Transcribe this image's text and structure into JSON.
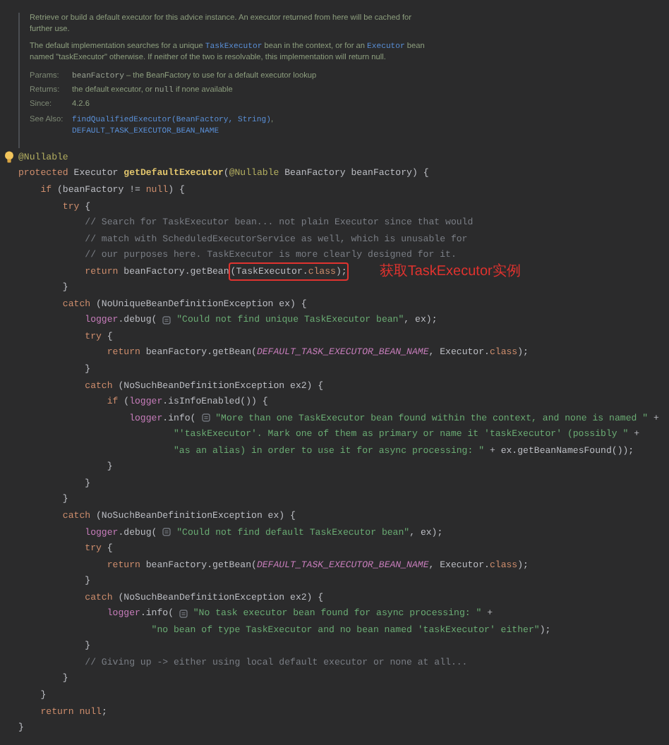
{
  "doc": {
    "paragraphs": [
      [
        {
          "kind": "text",
          "text": "Retrieve or build a default executor for this advice instance. An executor returned from here will be cached for further use."
        }
      ],
      [
        {
          "kind": "text",
          "text": "The default implementation searches for a unique "
        },
        {
          "kind": "link",
          "text": "TaskExecutor"
        },
        {
          "kind": "text",
          "text": " bean in the context, or for an "
        },
        {
          "kind": "link",
          "text": "Executor"
        },
        {
          "kind": "text",
          "text": " bean named \"taskExecutor\" otherwise. If neither of the two is resolvable, this implementation will return null."
        }
      ]
    ],
    "tags": [
      {
        "label": "Params:",
        "lines": [
          [
            {
              "kind": "code",
              "text": "beanFactory"
            },
            {
              "kind": "text",
              "text": " – the BeanFactory to use for a default executor lookup"
            }
          ]
        ]
      },
      {
        "label": "Returns:",
        "lines": [
          [
            {
              "kind": "text",
              "text": "the default executor, or "
            },
            {
              "kind": "code",
              "text": "null"
            },
            {
              "kind": "text",
              "text": " if none available"
            }
          ]
        ]
      },
      {
        "label": "Since:",
        "lines": [
          [
            {
              "kind": "text",
              "text": "4.2.6"
            }
          ]
        ]
      },
      {
        "label": "See Also:",
        "lines": [
          [
            {
              "kind": "link",
              "text": "findQualifiedExecutor(BeanFactory, String)"
            },
            {
              "kind": "text",
              "text": ","
            }
          ],
          [
            {
              "kind": "link",
              "text": "DEFAULT_TASK_EXECUTOR_BEAN_NAME"
            }
          ]
        ]
      }
    ]
  },
  "code": [
    {
      "lightbulb": true,
      "tokens": [
        {
          "kind": "annotation",
          "text": "@Nullable"
        }
      ]
    },
    {
      "tokens": [
        {
          "kind": "keyword",
          "text": "protected"
        },
        {
          "kind": "plain",
          "text": " Executor "
        },
        {
          "kind": "method",
          "text": "getDefaultExecutor"
        },
        {
          "kind": "plain",
          "text": "("
        },
        {
          "kind": "annotation",
          "text": "@Nullable"
        },
        {
          "kind": "plain",
          "text": " BeanFactory beanFactory) {"
        }
      ]
    },
    {
      "tokens": [
        {
          "kind": "keyword",
          "text": "    if"
        },
        {
          "kind": "plain",
          "text": " (beanFactory != "
        },
        {
          "kind": "keyword",
          "text": "null"
        },
        {
          "kind": "plain",
          "text": ") {"
        }
      ]
    },
    {
      "tokens": [
        {
          "kind": "keyword",
          "text": "        try"
        },
        {
          "kind": "plain",
          "text": " {"
        }
      ]
    },
    {
      "tokens": [
        {
          "kind": "comment",
          "text": "            // Search for TaskExecutor bean... not plain Executor since that would"
        }
      ]
    },
    {
      "tokens": [
        {
          "kind": "comment",
          "text": "            // match with ScheduledExecutorService as well, which is unusable for"
        }
      ]
    },
    {
      "tokens": [
        {
          "kind": "comment",
          "text": "            // our purposes here. TaskExecutor is more clearly designed for it."
        }
      ]
    },
    {
      "callout": "获取TaskExecutor实例",
      "tokens": [
        {
          "kind": "keyword",
          "text": "            return"
        },
        {
          "kind": "plain",
          "text": " beanFactory.getBean"
        },
        {
          "kind": "box",
          "tokens": [
            {
              "kind": "plain",
              "text": "(TaskExecutor."
            },
            {
              "kind": "keyword",
              "text": "class"
            },
            {
              "kind": "plain",
              "text": ");"
            }
          ]
        }
      ]
    },
    {
      "tokens": [
        {
          "kind": "plain",
          "text": "        }"
        }
      ]
    },
    {
      "tokens": [
        {
          "kind": "keyword",
          "text": "        catch"
        },
        {
          "kind": "plain",
          "text": " (NoUniqueBeanDefinitionException ex) {"
        }
      ]
    },
    {
      "tokens": [
        {
          "kind": "field",
          "text": "            logger"
        },
        {
          "kind": "plain",
          "text": ".debug( "
        },
        {
          "kind": "hint"
        },
        {
          "kind": "string",
          "text": " \"Could not find unique TaskExecutor bean\""
        },
        {
          "kind": "plain",
          "text": ", ex);"
        }
      ]
    },
    {
      "tokens": [
        {
          "kind": "keyword",
          "text": "            try"
        },
        {
          "kind": "plain",
          "text": " {"
        }
      ]
    },
    {
      "tokens": [
        {
          "kind": "keyword",
          "text": "                return"
        },
        {
          "kind": "plain",
          "text": " beanFactory.getBean("
        },
        {
          "kind": "constant",
          "text": "DEFAULT_TASK_EXECUTOR_BEAN_NAME"
        },
        {
          "kind": "plain",
          "text": ", Executor."
        },
        {
          "kind": "keyword",
          "text": "class"
        },
        {
          "kind": "plain",
          "text": ");"
        }
      ]
    },
    {
      "tokens": [
        {
          "kind": "plain",
          "text": "            }"
        }
      ]
    },
    {
      "tokens": [
        {
          "kind": "keyword",
          "text": "            catch"
        },
        {
          "kind": "plain",
          "text": " (NoSuchBeanDefinitionException ex2) {"
        }
      ]
    },
    {
      "tokens": [
        {
          "kind": "keyword",
          "text": "                if"
        },
        {
          "kind": "plain",
          "text": " ("
        },
        {
          "kind": "field",
          "text": "logger"
        },
        {
          "kind": "plain",
          "text": ".isInfoEnabled()) {"
        }
      ]
    },
    {
      "tokens": [
        {
          "kind": "field",
          "text": "                    logger"
        },
        {
          "kind": "plain",
          "text": ".info( "
        },
        {
          "kind": "hint"
        },
        {
          "kind": "string",
          "text": " \"More than one TaskExecutor bean found within the context, and none is named \""
        },
        {
          "kind": "plain",
          "text": " +"
        }
      ]
    },
    {
      "tokens": [
        {
          "kind": "string",
          "text": "                            \"'taskExecutor'. Mark one of them as primary or name it 'taskExecutor' (possibly \""
        },
        {
          "kind": "plain",
          "text": " +"
        }
      ]
    },
    {
      "tokens": [
        {
          "kind": "string",
          "text": "                            \"as an alias) in order to use it for async processing: \""
        },
        {
          "kind": "plain",
          "text": " + ex.getBeanNamesFound());"
        }
      ]
    },
    {
      "tokens": [
        {
          "kind": "plain",
          "text": "                }"
        }
      ]
    },
    {
      "tokens": [
        {
          "kind": "plain",
          "text": "            }"
        }
      ]
    },
    {
      "tokens": [
        {
          "kind": "plain",
          "text": "        }"
        }
      ]
    },
    {
      "tokens": [
        {
          "kind": "keyword",
          "text": "        catch"
        },
        {
          "kind": "plain",
          "text": " (NoSuchBeanDefinitionException ex) {"
        }
      ]
    },
    {
      "tokens": [
        {
          "kind": "field",
          "text": "            logger"
        },
        {
          "kind": "plain",
          "text": ".debug( "
        },
        {
          "kind": "hint"
        },
        {
          "kind": "string",
          "text": " \"Could not find default TaskExecutor bean\""
        },
        {
          "kind": "plain",
          "text": ", ex);"
        }
      ]
    },
    {
      "tokens": [
        {
          "kind": "keyword",
          "text": "            try"
        },
        {
          "kind": "plain",
          "text": " {"
        }
      ]
    },
    {
      "tokens": [
        {
          "kind": "keyword",
          "text": "                return"
        },
        {
          "kind": "plain",
          "text": " beanFactory.getBean("
        },
        {
          "kind": "constant",
          "text": "DEFAULT_TASK_EXECUTOR_BEAN_NAME"
        },
        {
          "kind": "plain",
          "text": ", Executor."
        },
        {
          "kind": "keyword",
          "text": "class"
        },
        {
          "kind": "plain",
          "text": ");"
        }
      ]
    },
    {
      "tokens": [
        {
          "kind": "plain",
          "text": "            }"
        }
      ]
    },
    {
      "tokens": [
        {
          "kind": "keyword",
          "text": "            catch"
        },
        {
          "kind": "plain",
          "text": " (NoSuchBeanDefinitionException ex2) {"
        }
      ]
    },
    {
      "tokens": [
        {
          "kind": "field",
          "text": "                logger"
        },
        {
          "kind": "plain",
          "text": ".info( "
        },
        {
          "kind": "hint"
        },
        {
          "kind": "string",
          "text": " \"No task executor bean found for async processing: \""
        },
        {
          "kind": "plain",
          "text": " +"
        }
      ]
    },
    {
      "tokens": [
        {
          "kind": "string",
          "text": "                        \"no bean of type TaskExecutor and no bean named 'taskExecutor' either\""
        },
        {
          "kind": "plain",
          "text": ");"
        }
      ]
    },
    {
      "tokens": [
        {
          "kind": "plain",
          "text": "            }"
        }
      ]
    },
    {
      "tokens": [
        {
          "kind": "comment",
          "text": "            // Giving up -> either using local default executor or none at all..."
        }
      ]
    },
    {
      "tokens": [
        {
          "kind": "plain",
          "text": "        }"
        }
      ]
    },
    {
      "tokens": [
        {
          "kind": "plain",
          "text": "    }"
        }
      ]
    },
    {
      "tokens": [
        {
          "kind": "keyword",
          "text": "    return null"
        },
        {
          "kind": "plain",
          "text": ";"
        }
      ]
    },
    {
      "tokens": [
        {
          "kind": "plain",
          "text": "}"
        }
      ]
    }
  ]
}
